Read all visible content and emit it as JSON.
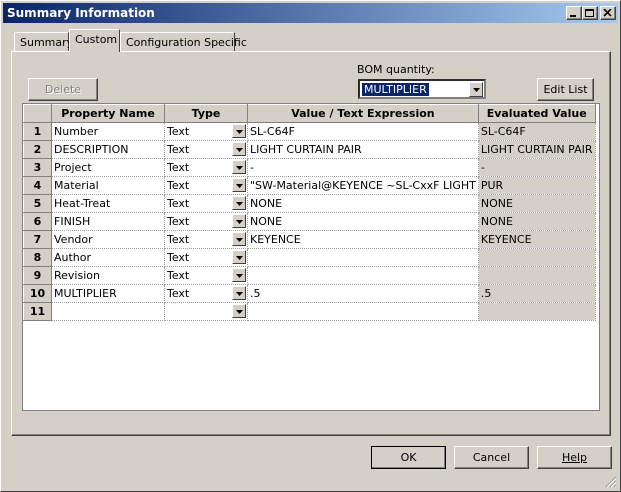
{
  "window": {
    "title": "Summary Information"
  },
  "tabs": [
    {
      "label": "Summary",
      "active": false
    },
    {
      "label": "Custom",
      "active": true
    },
    {
      "label": "Configuration Specific",
      "active": false
    }
  ],
  "toolbar": {
    "delete_label": "Delete",
    "bom_label": "BOM quantity:",
    "bom_value": "MULTIPLIER",
    "edit_list_label": "Edit List"
  },
  "grid": {
    "headers": [
      "Property Name",
      "Type",
      "Value / Text Expression",
      "Evaluated Value"
    ],
    "rows": [
      {
        "num": "1",
        "name": "Number",
        "type": "Text",
        "value": "SL-C64F",
        "evaluated": "SL-C64F"
      },
      {
        "num": "2",
        "name": "DESCRIPTION",
        "type": "Text",
        "value": "LIGHT CURTAIN PAIR",
        "evaluated": "LIGHT CURTAIN PAIR"
      },
      {
        "num": "3",
        "name": "Project",
        "type": "Text",
        "value": "-",
        "evaluated": "-"
      },
      {
        "num": "4",
        "name": "Material",
        "type": "Text",
        "value": "\"SW-Material@KEYENCE ~SL-CxxF LIGHT",
        "evaluated": "PUR"
      },
      {
        "num": "5",
        "name": "Heat-Treat",
        "type": "Text",
        "value": "NONE",
        "evaluated": "NONE"
      },
      {
        "num": "6",
        "name": "FINISH",
        "type": "Text",
        "value": "NONE",
        "evaluated": "NONE"
      },
      {
        "num": "7",
        "name": "Vendor",
        "type": "Text",
        "value": "KEYENCE",
        "evaluated": "KEYENCE"
      },
      {
        "num": "8",
        "name": "Author",
        "type": "Text",
        "value": "",
        "evaluated": ""
      },
      {
        "num": "9",
        "name": "Revision",
        "type": "Text",
        "value": "",
        "evaluated": ""
      },
      {
        "num": "10",
        "name": "MULTIPLIER",
        "type": "Text",
        "value": ".5",
        "evaluated": ".5"
      },
      {
        "num": "11",
        "name": "",
        "type": "",
        "value": "",
        "evaluated": ""
      }
    ]
  },
  "footer": {
    "ok_label": "OK",
    "cancel_label": "Cancel",
    "help_label": "Help"
  },
  "icons": {
    "minimize": "minimize-icon",
    "maximize": "maximize-icon",
    "close": "close-icon",
    "dropdown": "chevron-down-icon",
    "resize": "resize-grip-icon"
  }
}
